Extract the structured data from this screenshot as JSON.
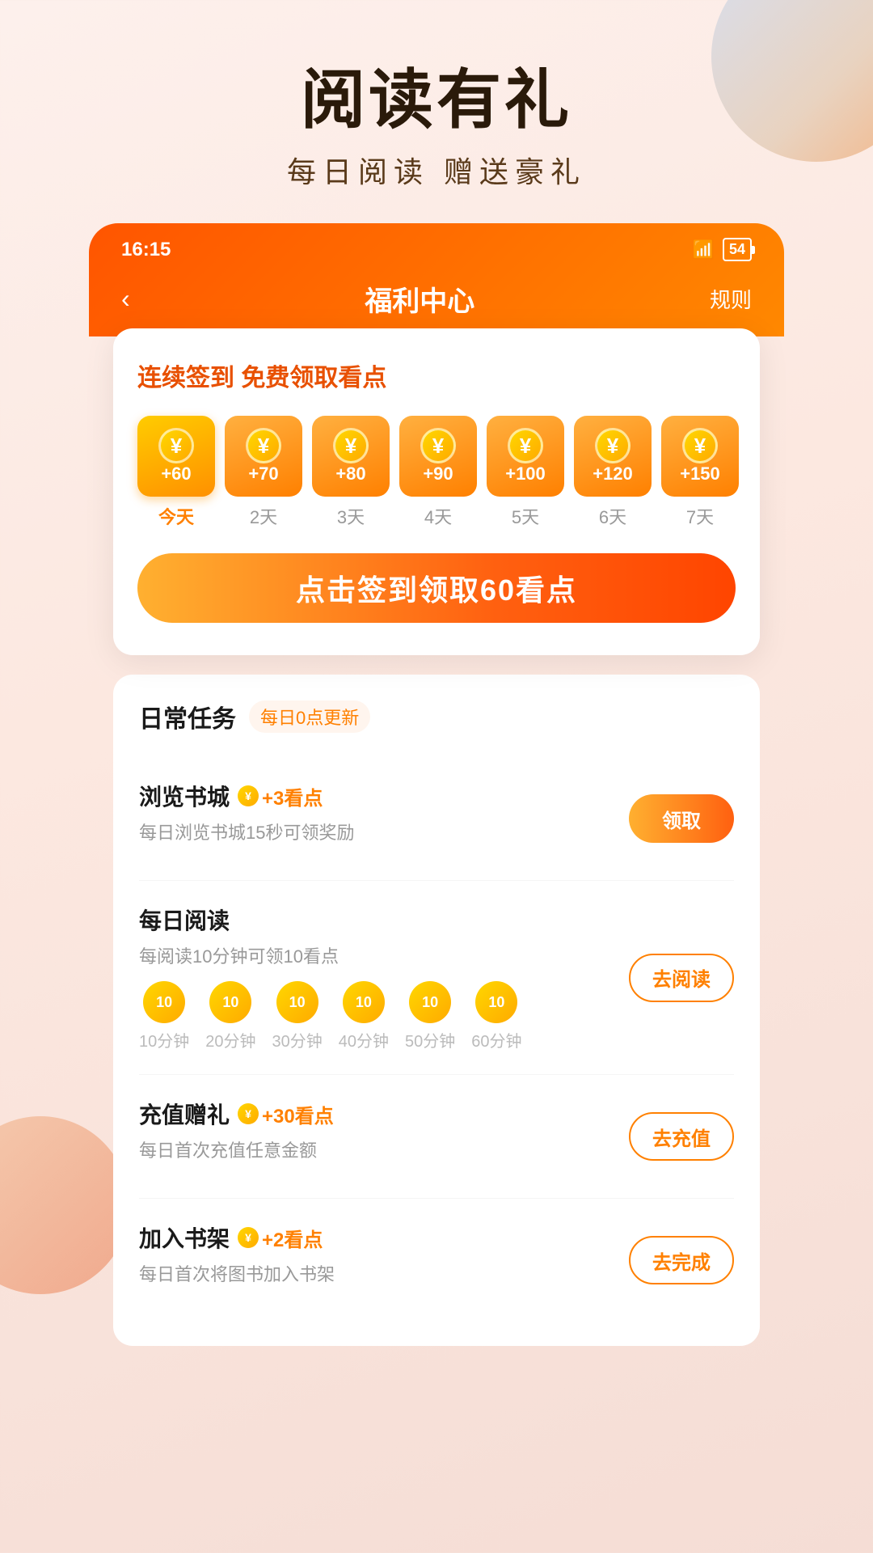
{
  "header": {
    "main_title": "阅读有礼",
    "sub_title": "每日阅读  赠送豪礼"
  },
  "status_bar": {
    "time": "16:15",
    "battery": "54",
    "wifi": "📶"
  },
  "nav": {
    "back": "‹",
    "title": "福利中心",
    "rule": "规则"
  },
  "signin_card": {
    "header": "连续签到 免费领取看点",
    "days": [
      {
        "amount": "+60",
        "label": "今天",
        "active": true
      },
      {
        "amount": "+70",
        "label": "2天",
        "active": false
      },
      {
        "amount": "+80",
        "label": "3天",
        "active": false
      },
      {
        "amount": "+90",
        "label": "4天",
        "active": false
      },
      {
        "amount": "+100",
        "label": "5天",
        "active": false
      },
      {
        "amount": "+120",
        "label": "6天",
        "active": false
      },
      {
        "amount": "+150",
        "label": "7天",
        "active": false
      }
    ],
    "btn_label": "点击签到领取60看点"
  },
  "tasks": {
    "title": "日常任务",
    "subtitle": "每日0点更新",
    "items": [
      {
        "name": "浏览书城",
        "reward": "+3看点",
        "desc": "每日浏览书城15秒可领奖励",
        "btn": "领取",
        "btn_filled": true,
        "show_progress": false
      },
      {
        "name": "每日阅读",
        "reward": "",
        "desc": "每阅读10分钟可领10看点",
        "btn": "去阅读",
        "btn_filled": false,
        "show_progress": true,
        "progress": [
          {
            "amount": "10",
            "label": "10分钟"
          },
          {
            "amount": "10",
            "label": "20分钟"
          },
          {
            "amount": "10",
            "label": "30分钟"
          },
          {
            "amount": "10",
            "label": "40分钟"
          },
          {
            "amount": "10",
            "label": "50分钟"
          },
          {
            "amount": "10",
            "label": "60分钟"
          }
        ]
      },
      {
        "name": "充值赠礼",
        "reward": "+30看点",
        "desc": "每日首次充值任意金额",
        "btn": "去充值",
        "btn_filled": false,
        "show_progress": false
      },
      {
        "name": "加入书架",
        "reward": "+2看点",
        "desc": "每日首次将图书加入书架",
        "btn": "去完成",
        "btn_filled": false,
        "show_progress": false
      }
    ]
  }
}
